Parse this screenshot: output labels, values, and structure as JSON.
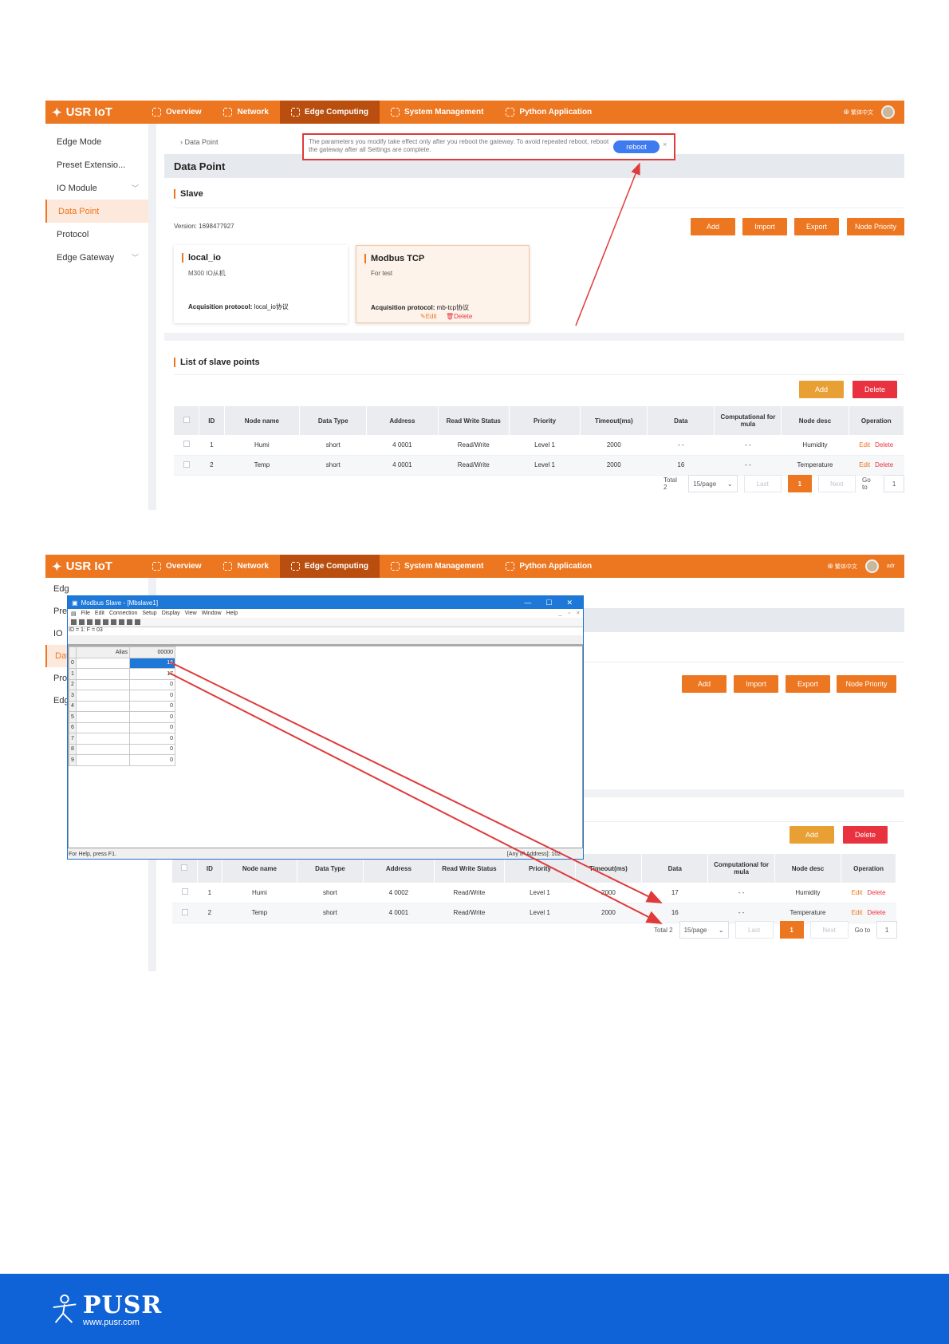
{
  "nav": {
    "brand": "USR IoT",
    "items": [
      "Overview",
      "Network",
      "Edge Computing",
      "System Management",
      "Python Application"
    ],
    "lang": "繁体中文",
    "user": "adr"
  },
  "sidebar": {
    "items": [
      "Edge Mode",
      "Preset Extensio...",
      "IO Module",
      "Data Point",
      "Protocol",
      "Edge Gateway"
    ],
    "peek": [
      "Edg",
      "Pre",
      "IO",
      "Dat",
      "Pro",
      "Edg"
    ]
  },
  "notice": {
    "text": "The parameters you modify take effect only after you reboot the gateway. To avoid repeated reboot, reboot the gateway after all Settings are complete.",
    "button": "reboot",
    "close": "×"
  },
  "breadcrumb": "Data Point",
  "page_title": "Data Point",
  "slave": {
    "title": "Slave",
    "version_label": "Version:",
    "version": "1698477927",
    "buttons": [
      "Add",
      "Import",
      "Export",
      "Node Priority"
    ],
    "cards": [
      {
        "title": "local_io",
        "desc": "M300 IO从机",
        "proto_label": "Acquisition protocol:",
        "proto": "local_io协议"
      },
      {
        "title": "Modbus TCP",
        "desc": "For test",
        "proto_label": "Acquisition protocol:",
        "proto": "mb-tcp协议",
        "edit": "Edit",
        "delete": "Delete"
      }
    ]
  },
  "points": {
    "title": "List of slave points",
    "add": "Add",
    "delete": "Delete",
    "headers": [
      "ID",
      "Node name",
      "Data Type",
      "Address",
      "Read Write Status",
      "Priority",
      "Timeout(ms)",
      "Data",
      "Computational for mula",
      "Node desc",
      "Operation"
    ],
    "op_edit": "Edit",
    "op_delete": "Delete",
    "rows_before": [
      [
        "1",
        "Humi",
        "short",
        "4 0001",
        "Read/Write",
        "Level 1",
        "2000",
        "- -",
        "- -",
        "Humidity"
      ],
      [
        "2",
        "Temp",
        "short",
        "4 0001",
        "Read/Write",
        "Level 1",
        "2000",
        "16",
        "- -",
        "Temperature"
      ]
    ],
    "rows_after": [
      [
        "1",
        "Humi",
        "short",
        "4 0002",
        "Read/Write",
        "Level 1",
        "2000",
        "17",
        "- -",
        "Humidity"
      ],
      [
        "2",
        "Temp",
        "short",
        "4 0001",
        "Read/Write",
        "Level 1",
        "2000",
        "16",
        "- -",
        "Temperature"
      ]
    ]
  },
  "pager": {
    "total": "Total 2",
    "per_page": "15/page",
    "prev": "Last",
    "current": "1",
    "next": "Next",
    "goto_label": "Go to",
    "goto_value": "1"
  },
  "modbus": {
    "title": "Modbus Slave - [Mbslave1]",
    "menu": [
      "File",
      "Edit",
      "Connection",
      "Setup",
      "Display",
      "View",
      "Window",
      "Help"
    ],
    "id_line": "ID = 1: F = 03",
    "alias_header": "Alias",
    "value_header": "00000",
    "rows": [
      "0",
      "1",
      "2",
      "3",
      "4",
      "5",
      "6",
      "7",
      "8",
      "9"
    ],
    "values": [
      "16",
      "17",
      "0",
      "0",
      "0",
      "0",
      "0",
      "0",
      "0",
      "0"
    ],
    "status_left": "For Help, press F1.",
    "status_right": "[Any IP Address]: 102"
  },
  "footer": {
    "logo": "PUSR",
    "url": "www.pusr.com"
  },
  "colors": {
    "brand_orange": "#ed7620",
    "nav_active": "#b94e0e",
    "footer_blue": "#0f63d6",
    "annotation_red": "#e03a3a"
  }
}
